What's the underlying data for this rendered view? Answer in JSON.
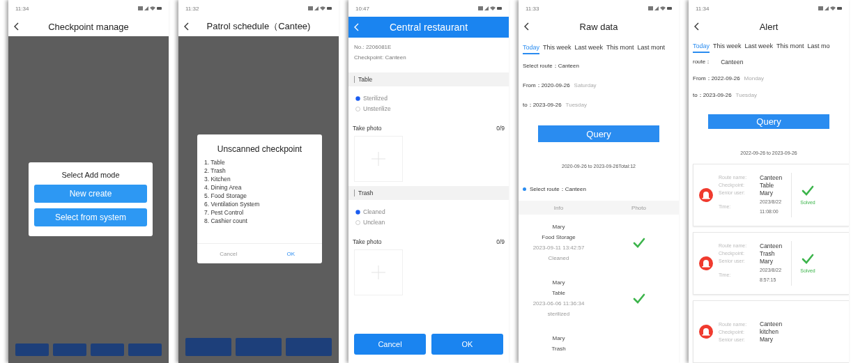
{
  "screens": [
    {
      "kind": "add_mode",
      "status_time": "11:34",
      "title": "Checkpoint manage",
      "dialog": {
        "title": "Select Add mode",
        "buttons": [
          "New create",
          "Select from system"
        ]
      }
    },
    {
      "kind": "unscanned",
      "status_time": "11:32",
      "title": "Patrol schedule（Cantee)",
      "dialog": {
        "title": "Unscanned checkpoint",
        "items": [
          "1. Table",
          "2. Trash",
          "3. Kitchen",
          "4. Dining Area",
          "5. Food Storage",
          "6. Ventilation System",
          "7. Pest Control",
          "8. Cashier count"
        ],
        "buttons": [
          "Cancel",
          "OK"
        ]
      }
    },
    {
      "kind": "inspection",
      "status_time": "10:47",
      "title": "Central restaurant",
      "number": "No.: 2206081E",
      "checkpoint": "Checkpoint: Canteen",
      "sections": [
        {
          "name": "Table",
          "options": [
            {
              "label": "Sterilized",
              "selected": true
            },
            {
              "label": "Unsterilize",
              "selected": false
            }
          ],
          "photo_label": "Take photo",
          "photo_count": "0/9"
        },
        {
          "name": "Trash",
          "options": [
            {
              "label": "Cleaned",
              "selected": true
            },
            {
              "label": "Unclean",
              "selected": false
            }
          ],
          "photo_label": "Take photo",
          "photo_count": "0/9"
        }
      ],
      "buttons": [
        "Cancel",
        "OK"
      ]
    },
    {
      "kind": "raw_data",
      "status_time": "11:33",
      "title": "Raw data",
      "tabs": [
        {
          "label": "Today",
          "selected": true
        },
        {
          "label": "This week",
          "selected": false
        },
        {
          "label": "Last week",
          "selected": false
        },
        {
          "label": "This mont",
          "selected": false
        },
        {
          "label": "Last mont",
          "selected": false
        }
      ],
      "route": "Select route：Canteen",
      "from": {
        "text": "From：2020-09-26",
        "weekday": "Saturday"
      },
      "to": {
        "text": "to：2023-09-26",
        "weekday": "Tuesday"
      },
      "query": "Query",
      "summary": "2020-09-26 to 2023-09-26Total:12",
      "route_marker": "Select route：Canteen",
      "table": {
        "columns": [
          "Info",
          "Photo"
        ],
        "rows": [
          {
            "lines": [
              "Mary",
              "Food Storage",
              "2023-09-11 13:42:57",
              "Cleaned"
            ],
            "photo_check": true
          },
          {
            "lines": [
              "Mary",
              "Table",
              "2023-06-06 11:36:34",
              "sterilized"
            ],
            "photo_check": true
          },
          {
            "lines": [
              "Mary",
              "Trash"
            ]
          }
        ]
      }
    },
    {
      "kind": "alert",
      "status_time": "11:34",
      "title": "Alert",
      "tabs": [
        {
          "label": "Today",
          "selected": true
        },
        {
          "label": "This week",
          "selected": false
        },
        {
          "label": "Last week",
          "selected": false
        },
        {
          "label": "This mont",
          "selected": false
        },
        {
          "label": "Last mo",
          "selected": false
        }
      ],
      "route": {
        "label": "route：",
        "value": "Canteen"
      },
      "from": {
        "text": "From：2022-09-26",
        "weekday": "Monday"
      },
      "to": {
        "text": "to：2023-09-26",
        "weekday": "Tuesday"
      },
      "query": "Query",
      "summary": "2022-09-26 to 2023-09-26",
      "alerts": [
        {
          "fields": [
            {
              "label": "Route name:",
              "value": "Canteen"
            },
            {
              "label": "Checkpoint:",
              "value": "Table"
            },
            {
              "label": "Senior user:",
              "value": "Mary"
            }
          ],
          "time": {
            "label": "Time:",
            "date": "2023/8/22",
            "clock": "11:08:00"
          },
          "status": "Solved"
        },
        {
          "fields": [
            {
              "label": "Route name:",
              "value": "Canteen"
            },
            {
              "label": "Checkpoint:",
              "value": "Trash"
            },
            {
              "label": "Senior user:",
              "value": "Mary"
            }
          ],
          "time": {
            "label": "Time:",
            "date": "2023/8/22",
            "clock": "8:57:15"
          },
          "status": "Solved"
        },
        {
          "fields": [
            {
              "label": "Route name:",
              "value": "Canteen"
            },
            {
              "label": "Checkpoint:",
              "value": "kitchen"
            },
            {
              "label": "Senior user:",
              "value": "Mary"
            }
          ]
        }
      ]
    }
  ]
}
